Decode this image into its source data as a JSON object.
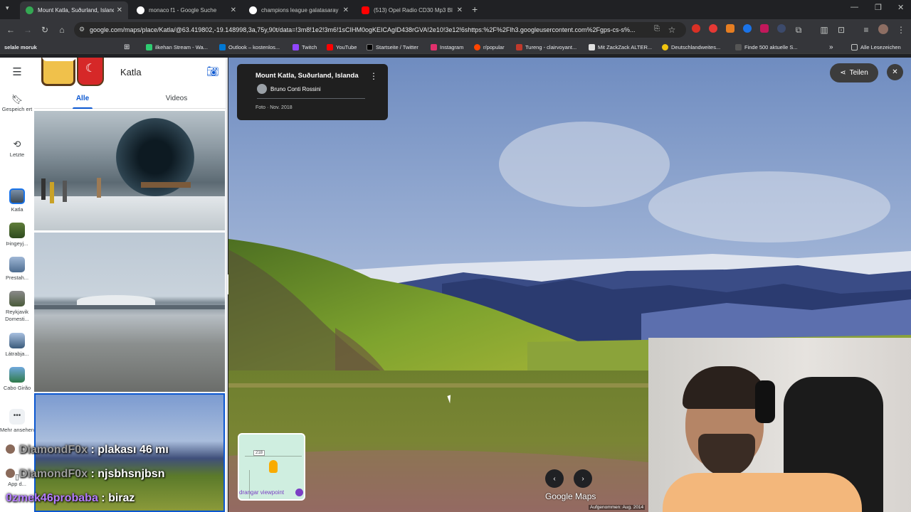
{
  "browser": {
    "tabs": [
      {
        "title": "Mount Katla, Suðurland, Island",
        "active": true,
        "favicon_color": "#34a853"
      },
      {
        "title": "monaco f1 - Google Suche",
        "active": false,
        "favicon_color": "#ffffff"
      },
      {
        "title": "champions league galatasaray",
        "active": false,
        "favicon_color": "#ffffff"
      },
      {
        "title": "(513) Opel Radio CD30 Mp3 Bl",
        "active": false,
        "favicon_color": "#ff0000"
      }
    ],
    "new_tab": "+",
    "url": "google.com/maps/place/Katla/@63.419802,-19.148998,3a,75y,90t/data=!3m8!1e2!3m6!1sCIHM0ogKEICAgID438rGVA!2e10!3e12!6shttps:%2F%2Flh3.googleusercontent.com%2Fgps-cs-s%...",
    "bookmarks": [
      {
        "label": "selale moruk",
        "color": "#35363a"
      },
      {
        "label": "ilkehan Stream - Wa...",
        "color": "#2ecc71"
      },
      {
        "label": "Outlook – kostenlos...",
        "color": "#0078d4"
      },
      {
        "label": "Twitch",
        "color": "#9146ff"
      },
      {
        "label": "YouTube",
        "color": "#ff0000"
      },
      {
        "label": "Startseite / Twitter",
        "color": "#000000"
      },
      {
        "label": "Instagram",
        "color": "#e1306c"
      },
      {
        "label": "r/popular",
        "color": "#ff4500"
      },
      {
        "label": "Tureng - clairvoyant...",
        "color": "#c0392b"
      },
      {
        "label": "Mit ZackZack ALTER...",
        "color": "#e0e0e0"
      },
      {
        "label": "Deutschlandweites...",
        "color": "#f1c40f"
      },
      {
        "label": "Finde 500 aktuelle S...",
        "color": "#555555"
      }
    ],
    "all_bookmarks": "Alle Lesezeichen",
    "more_bookmarks": "»"
  },
  "maps": {
    "menu_icon": "hamburger-icon",
    "rail": [
      {
        "label": "Gespeich ert",
        "icon": "bookmark-icon"
      },
      {
        "label": "Letzte",
        "icon": "history-icon"
      },
      {
        "label": "Katla",
        "icon": "place-thumb"
      },
      {
        "label": "Þingeyj...",
        "icon": "place-thumb"
      },
      {
        "label": "Prestah...",
        "icon": "place-thumb"
      },
      {
        "label": "Reykjavik Domesti...",
        "icon": "place-thumb"
      },
      {
        "label": "Látrabja...",
        "icon": "place-thumb"
      },
      {
        "label": "Cabo Girão",
        "icon": "place-thumb"
      },
      {
        "label": "Mehr ansehen",
        "icon": "more-icon"
      }
    ],
    "rail_bottom": "App d...",
    "panel": {
      "title": "Katla",
      "tabs": [
        {
          "label": "Alle"
        },
        {
          "label": "Videos"
        }
      ]
    },
    "photo_card": {
      "title": "Mount Katla, Suðurland, Islanda",
      "author": "Bruno Conti Rossini",
      "date": "Foto · Nov. 2018"
    },
    "share_label": "Teilen",
    "minimap": {
      "road_number": "218",
      "label": "drangar viewpoint"
    },
    "branding": "Google Maps",
    "capture_date": "Aufgenommen: Aug. 2014"
  },
  "chat": [
    {
      "user": "DiamondF0x",
      "message": " : plakası 46 mı",
      "color": "#9c9c9c"
    },
    {
      "user": "DiamondF0x",
      "message": " : njsbhsnjbsn",
      "color": "#9c9c9c"
    },
    {
      "user": "0zmek46probaba",
      "message": " : biraz",
      "color": "#b47cff"
    }
  ]
}
